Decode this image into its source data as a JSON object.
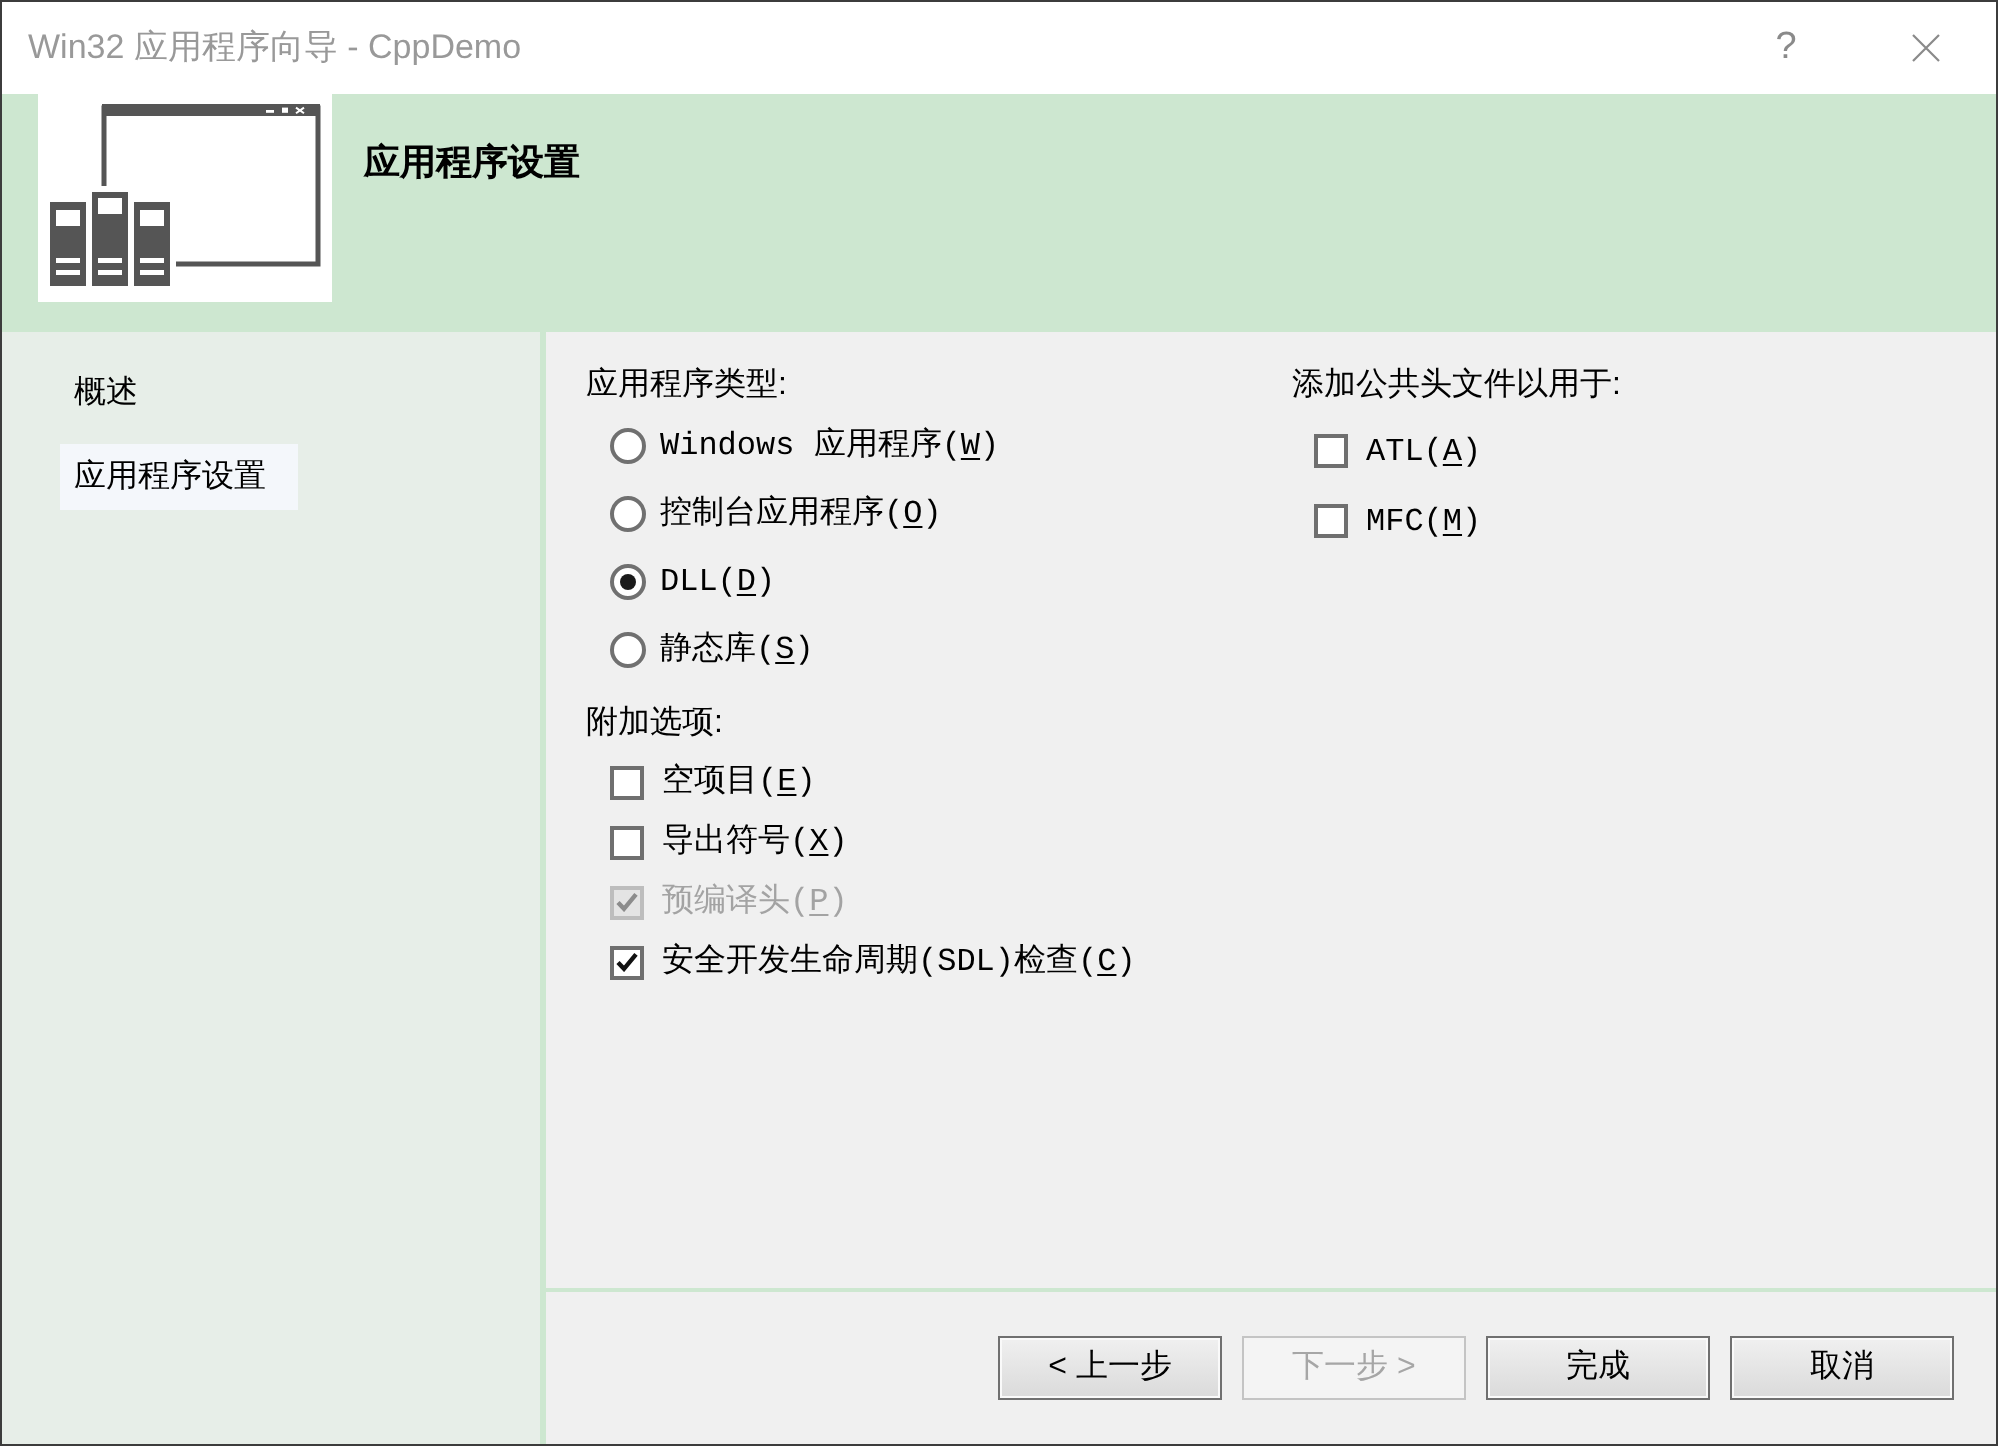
{
  "window": {
    "title": "Win32 应用程序向导 - CppDemo",
    "help_button": "?"
  },
  "header": {
    "title": "应用程序设置"
  },
  "sidebar": {
    "items": [
      {
        "label": "概述",
        "selected": false
      },
      {
        "label": "应用程序设置",
        "selected": true
      }
    ]
  },
  "application_type": {
    "heading": "应用程序类型:",
    "options": [
      {
        "label_start": "Windows 应用程序(",
        "access_key": "W",
        "label_end": ")",
        "selected": false
      },
      {
        "label_start": "控制台应用程序(",
        "access_key": "O",
        "label_end": ")",
        "selected": false
      },
      {
        "label_start": "DLL(",
        "access_key": "D",
        "label_end": ")",
        "selected": true
      },
      {
        "label_start": "静态库(",
        "access_key": "S",
        "label_end": ")",
        "selected": false
      }
    ]
  },
  "additional_options": {
    "heading": "附加选项:",
    "options": [
      {
        "label_start": "空项目(",
        "access_key": "E",
        "label_end": ")",
        "checked": false,
        "disabled": false
      },
      {
        "label_start": "导出符号(",
        "access_key": "X",
        "label_end": ")",
        "checked": false,
        "disabled": false
      },
      {
        "label_start": "预编译头(",
        "access_key": "P",
        "label_end": ")",
        "checked": true,
        "disabled": true
      },
      {
        "label_start": "安全开发生命周期(SDL)检查(",
        "access_key": "C",
        "label_end": ")",
        "checked": true,
        "disabled": false
      }
    ]
  },
  "common_headers": {
    "heading": "添加公共头文件以用于:",
    "options": [
      {
        "label_start": "ATL(",
        "access_key": "A",
        "label_end": ")",
        "checked": false,
        "disabled": false
      },
      {
        "label_start": "MFC(",
        "access_key": "M",
        "label_end": ")",
        "checked": false,
        "disabled": false
      }
    ]
  },
  "buttons": [
    {
      "label": "< 上一步",
      "disabled": false
    },
    {
      "label": "下一步 >",
      "disabled": true
    },
    {
      "label": "完成",
      "disabled": false
    },
    {
      "label": "取消",
      "disabled": false
    }
  ]
}
